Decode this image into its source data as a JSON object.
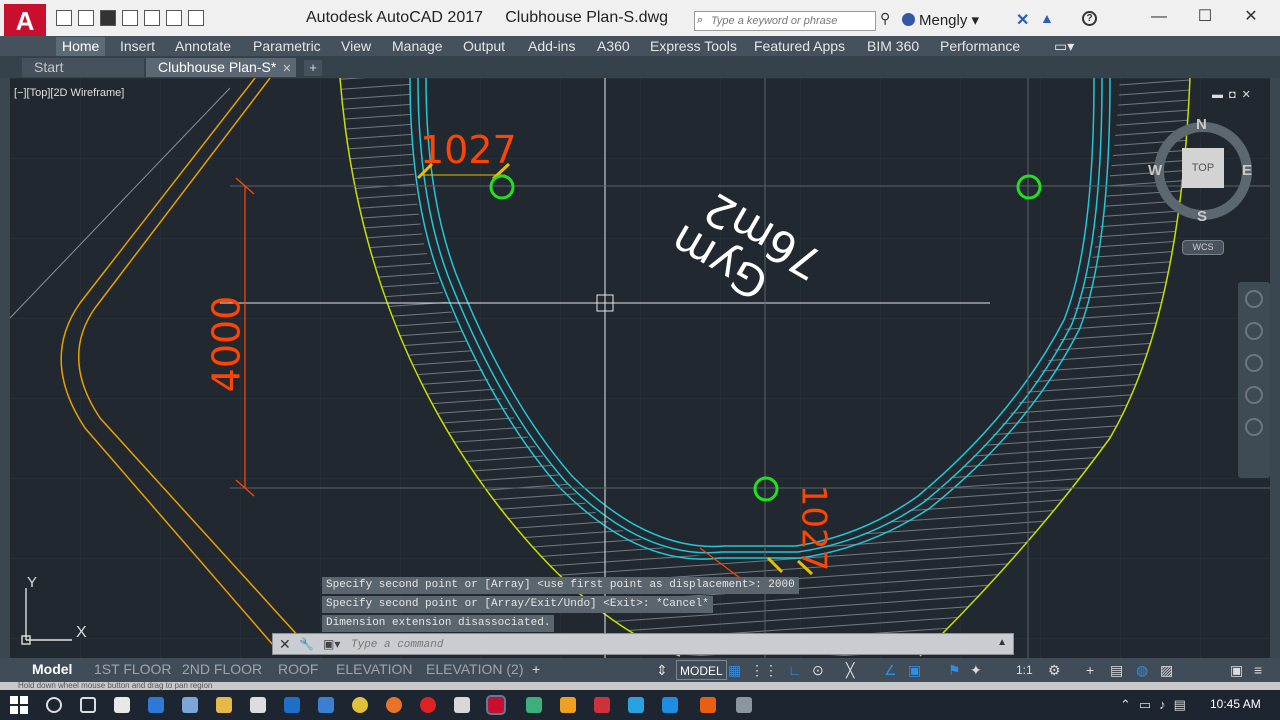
{
  "window": {
    "title": "Autodesk AutoCAD 2017",
    "file": "Clubhouse Plan-S.dwg",
    "search_placeholder": "Type a keyword or phrase",
    "user": "Mengly"
  },
  "ribbon_tabs": [
    "Home",
    "Insert",
    "Annotate",
    "Parametric",
    "View",
    "Manage",
    "Output",
    "Add-ins",
    "A360",
    "Express Tools",
    "Featured Apps",
    "BIM 360",
    "Performance"
  ],
  "file_tabs": {
    "start": "Start",
    "doc": "Clubhouse Plan-S*"
  },
  "viewport": {
    "label": "[−][Top][2D Wireframe]"
  },
  "viewcube": {
    "north": "N",
    "south": "S",
    "east": "E",
    "west": "W",
    "top": "TOP",
    "wcs": "WCS"
  },
  "annotations": {
    "room_name": "Gym",
    "room_area": "76m2",
    "dim_top": "1027",
    "dim_left": "4000",
    "dim_bottom": "1027"
  },
  "ucs": {
    "x": "X",
    "y": "Y"
  },
  "command_history": [
    "Specify second point or [Array] <use first point as displacement>: 2000",
    "Specify second point or [Array/Exit/Undo] <Exit>: *Cancel*",
    "Dimension extension disassociated."
  ],
  "command_line": {
    "placeholder": "Type a command"
  },
  "layout_tabs": [
    "Model",
    "1ST FLOOR",
    "2ND FLOOR",
    "ROOF",
    "ELEVATION",
    "ELEVATION (2)"
  ],
  "status": {
    "model": "MODEL",
    "scale": "1:1",
    "hint": "Hold down wheel mouse button and drag to pan region"
  },
  "taskbar": {
    "time": "10:45 AM"
  },
  "colors": {
    "wall": "#22c8d8",
    "outer_curve": "#c8e000",
    "dimension": "#ff4500",
    "marker": "#20e020",
    "path": "#e8c000"
  }
}
